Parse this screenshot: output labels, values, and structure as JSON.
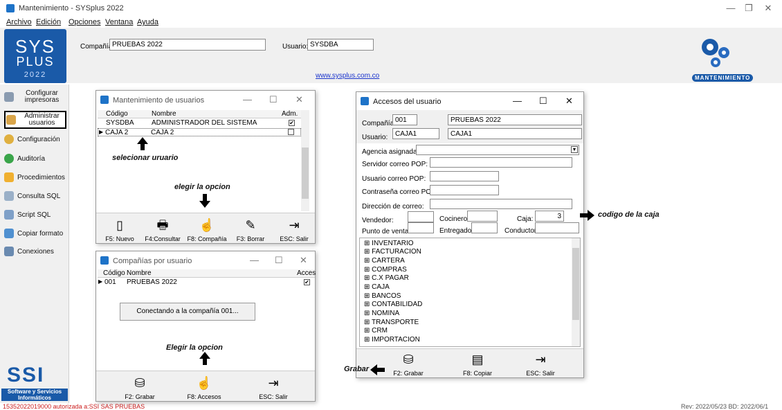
{
  "app": {
    "title": "Mantenimiento - SYSplus 2022",
    "menu": [
      "Archivo",
      "Edición",
      "Opciones",
      "Ventana",
      "Ayuda"
    ]
  },
  "header": {
    "logo_line1": "SYS",
    "logo_line2": "PLUS",
    "logo_year": "2022",
    "company_label": "Compañía:",
    "company_value": "PRUEBAS 2022",
    "user_label": "Usuario:",
    "user_value": "SYSDBA",
    "website": "www.sysplus.com.co",
    "badge": "MANTENIMIENTO"
  },
  "sidebar": {
    "items": [
      {
        "label": "Configurar impresoras",
        "icon": "printer-icon"
      },
      {
        "label": "Administrar usuarios",
        "icon": "users-icon"
      },
      {
        "label": "Configuración",
        "icon": "gear-icon"
      },
      {
        "label": "Auditoría",
        "icon": "check-icon"
      },
      {
        "label": "Procedimientos",
        "icon": "bolt-icon"
      },
      {
        "label": "Consulta SQL",
        "icon": "database-icon"
      },
      {
        "label": "Script SQL",
        "icon": "script-icon"
      },
      {
        "label": "Copiar formato",
        "icon": "copy-icon"
      },
      {
        "label": "Conexiones",
        "icon": "connection-icon"
      }
    ],
    "ssi_logo": "SSI",
    "ssi_sub": "Software y Servicios Informáticos"
  },
  "status": {
    "left": "15352022019000 autorizada a:SSI SAS PRUEBAS",
    "right": "Rev: 2022/05/23 BD: 2022/06/1"
  },
  "users_window": {
    "title": "Mantenimiento de usuarios",
    "columns": [
      "Código",
      "Nombre",
      "Adm."
    ],
    "rows": [
      {
        "code": "SYSDBA",
        "name": "ADMINISTRADOR DEL SISTEMA",
        "adm": "✔"
      },
      {
        "code": "CAJA 2",
        "name": "CAJA 2",
        "adm": ""
      }
    ],
    "buttons": [
      {
        "label": "F5: Nuevo",
        "icon": "new-icon"
      },
      {
        "label": "F4:Consultar",
        "icon": "print-icon"
      },
      {
        "label": "F8: Compañía",
        "icon": "hand-icon"
      },
      {
        "label": "F3: Borrar",
        "icon": "eraser-icon"
      },
      {
        "label": "ESC: Salir",
        "icon": "exit-icon"
      }
    ]
  },
  "companies_window": {
    "title": "Compañías por usuario",
    "columns": [
      "Código",
      "Nombre",
      "Acces"
    ],
    "rows": [
      {
        "code": "001",
        "name": "PRUEBAS 2022",
        "access": "✔"
      }
    ],
    "connecting_text": "Conectando a la compañía 001...",
    "buttons": [
      {
        "label": "F2: Grabar",
        "icon": "save-icon"
      },
      {
        "label": "F8: Accesos",
        "icon": "hand-icon"
      },
      {
        "label": "ESC: Salir",
        "icon": "exit-icon"
      }
    ]
  },
  "access_window": {
    "title": "Accesos del usuario",
    "company_label": "Compañía:",
    "company_code": "001",
    "company_name": "PRUEBAS 2022",
    "user_label": "Usuario:",
    "user_code": "CAJA1",
    "user_name": "CAJA1",
    "agency_label": "Agencia asignada:",
    "pop_server_label": "Servidor correo POP:",
    "pop_user_label": "Usuario correo POP:",
    "pop_pass_label": "Contraseña correo POP:",
    "email_label": "Dirección de correo:",
    "vendedor_label": "Vendedor:",
    "cocinero_label": "Cocinero:",
    "caja_label": "Caja:",
    "caja_value": "3",
    "punto_label": "Punto de venta:",
    "entregador_label": "Entregador:",
    "conductor_label": "Conductor:",
    "tree": [
      "INVENTARIO",
      "FACTURACION",
      "CARTERA",
      "COMPRAS",
      "C.X PAGAR",
      "CAJA",
      "BANCOS",
      "CONTABILIDAD",
      "NOMINA",
      "TRANSPORTE",
      "CRM",
      "IMPORTACION"
    ],
    "buttons": [
      {
        "label": "F2: Grabar",
        "icon": "save-icon"
      },
      {
        "label": "F8: Copiar",
        "icon": "copy-icon"
      },
      {
        "label": "ESC: Salir",
        "icon": "exit-icon"
      }
    ]
  },
  "annotations": {
    "select_user": "selecionar uruario",
    "choose_option1": "elegir la opcion",
    "choose_option2": "Elegir la opcion",
    "cash_code": "codigo de la caja",
    "save": "Grabar"
  }
}
